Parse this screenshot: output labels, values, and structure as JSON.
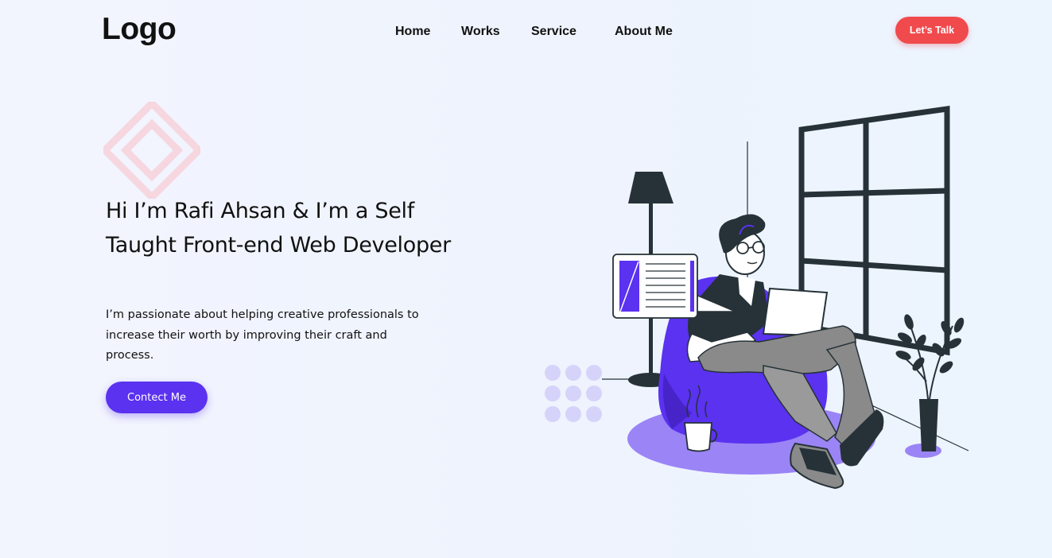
{
  "header": {
    "logo": "Logo",
    "nav": [
      {
        "label": "Home"
      },
      {
        "label": "Works"
      },
      {
        "label": "Service"
      },
      {
        "label": "About Me"
      }
    ],
    "cta_label": "Let’s Talk"
  },
  "hero": {
    "title": "Hi I’m Rafi Ahsan & I’m a Self Taught Front-end Web Developer",
    "description": "I’m passionate about helping creative professionals to increase their worth by improving their craft and process.",
    "button_label": "Contect Me"
  },
  "colors": {
    "accent": "#5a32f0",
    "cta": "#f04a4d",
    "dark": "#263238",
    "diamond": "#f6d6df"
  },
  "icons": {
    "decoration": "diamond-outline-icon",
    "illustration": "developer-on-beanbag-illustration"
  }
}
